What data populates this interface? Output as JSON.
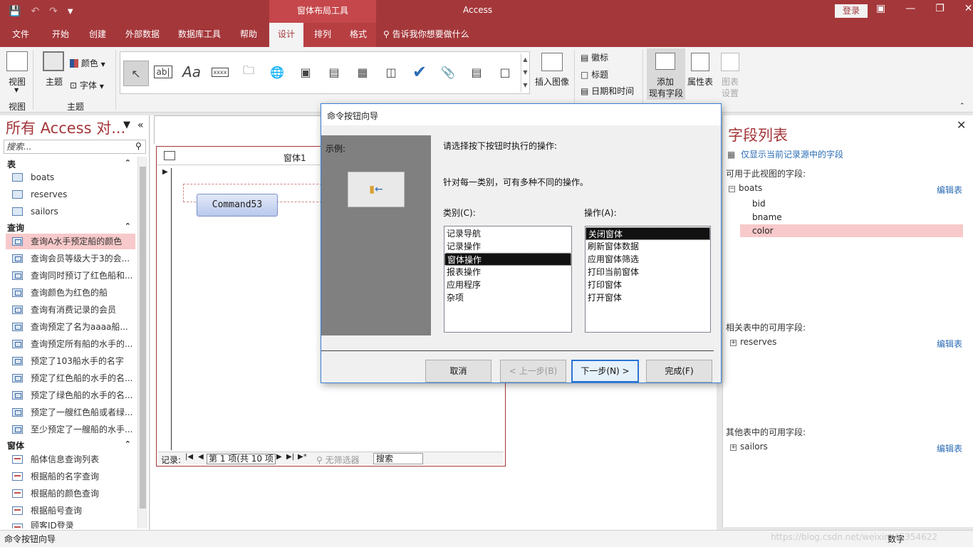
{
  "titlebar": {
    "context_tab": "窗体布局工具",
    "app_title": "Access",
    "login": "登录"
  },
  "menu": {
    "tabs": [
      "文件",
      "开始",
      "创建",
      "外部数据",
      "数据库工具",
      "帮助",
      "设计",
      "排列",
      "格式"
    ],
    "active_tab": "设计",
    "tell_me": "告诉我你想要做什么"
  },
  "ribbon": {
    "view_label": "视图",
    "view_group": "视图",
    "theme_label": "主题",
    "color_label": "颜色",
    "font_label": "字体",
    "theme_group": "主题",
    "insert_image": "插入图像",
    "logo": "徽标",
    "title": "标题",
    "datetime": "日期和时间",
    "add_fields_1": "添加",
    "add_fields_2": "现有字段",
    "property_sheet": "属性表",
    "chart_settings_1": "图表",
    "chart_settings_2": "设置"
  },
  "nav": {
    "title": "所有 Access 对...",
    "search_placeholder": "搜索...",
    "sections": [
      {
        "label": "表",
        "items": [
          "boats",
          "reserves",
          "sailors"
        ]
      },
      {
        "label": "查询",
        "items": [
          "查询A水手预定船的颜色",
          "查询会员等级大于3的会...",
          "查询同时预订了红色船和...",
          "查询颜色为红色的船",
          "查询有消费记录的会员",
          "查询预定了名为aaaa船...",
          "查询预定所有船的水手的...",
          "预定了103船水手的名字",
          "预定了红色船的水手的名...",
          "预定了绿色船的水手的名...",
          "预定了一艘红色船或者绿...",
          "至少预定了一艘船的水手..."
        ]
      },
      {
        "label": "窗体",
        "items": [
          "船体信息查询列表",
          "根据船的名字查询",
          "根据船的颜色查询",
          "根据船号查询",
          "顾客ID登录"
        ]
      }
    ],
    "selected_item": "查询A水手预定船的颜色"
  },
  "form": {
    "title": "窗体1",
    "command_button": "Command53",
    "record_label": "记录:",
    "record_position": "第 1 项(共 10 项",
    "no_filter": "无筛选器",
    "search": "搜索"
  },
  "fieldlist": {
    "title": "字段列表",
    "show_current_only": "仅显示当前记录源中的字段",
    "available_label": "可用于此视图的字段:",
    "table_name": "boats",
    "edit_table": "编辑表",
    "fields": [
      "bid",
      "bname",
      "color"
    ],
    "selected_field": "color",
    "related_label": "相关表中的可用字段:",
    "related_table": "reserves",
    "other_label": "其他表中的可用字段:",
    "other_table": "sailors"
  },
  "dialog": {
    "title": "命令按钮向导",
    "sample_label": "示例:",
    "prompt": "请选择按下按钮时执行的操作:",
    "info": "针对每一类别，可有多种不同的操作。",
    "category_label": "类别(C):",
    "action_label": "操作(A):",
    "categories": [
      "记录导航",
      "记录操作",
      "窗体操作",
      "报表操作",
      "应用程序",
      "杂项"
    ],
    "selected_category": "窗体操作",
    "actions": [
      "关闭窗体",
      "刷新窗体数据",
      "应用窗体筛选",
      "打印当前窗体",
      "打印窗体",
      "打开窗体"
    ],
    "selected_action": "关闭窗体",
    "buttons": {
      "cancel": "取消",
      "back": "< 上一步(B)",
      "next": "下一步(N) >",
      "finish": "完成(F)"
    }
  },
  "status": {
    "left": "命令按钮向导",
    "right": "数字"
  },
  "watermark": "https://blog.csdn.net/weixin_45354622",
  "colors": {
    "brand": "#a4373a",
    "selection": "#f8c9ca",
    "link": "#2b6cb5"
  }
}
